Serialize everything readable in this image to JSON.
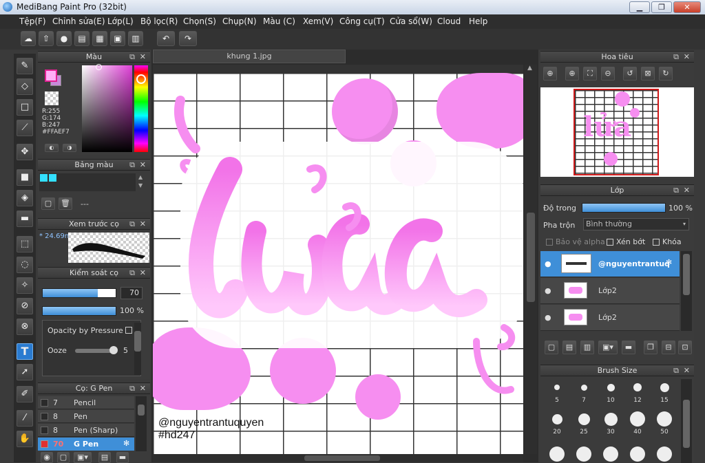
{
  "app": {
    "title": "MediBang Paint Pro (32bit)"
  },
  "window_controls": {
    "minimize": "▁",
    "maximize": "❐",
    "close": "✕"
  },
  "menu": [
    "Tệp(F)",
    "Chỉnh sửa(E)",
    "Lớp(L)",
    "Bộ lọc(R)",
    "Chọn(S)",
    "Chụp(N)",
    "Màu (C)",
    "Xem(V)",
    "Công cụ(T)",
    "Cửa sổ(W)",
    "Cloud",
    "Help"
  ],
  "document": {
    "tab": "khung 1.jpg"
  },
  "color_panel": {
    "title": "Màu",
    "rgb": {
      "r": "R:255",
      "g": "G:174",
      "b": "B:247"
    },
    "hex": "#FFAEF7",
    "colors": {
      "main": "#ffaef7",
      "sub": "#c78ad8"
    }
  },
  "palette_panel": {
    "title": "Bảng màu",
    "swatches": [
      "#33e0ff",
      "#33e0ff"
    ],
    "dash": "---"
  },
  "preview_panel": {
    "title": "Xem trước cọ",
    "value": "* 24.69n"
  },
  "brush_control": {
    "title": "Kiểm soát cọ",
    "size": "70",
    "opacity": "100 %",
    "size_fraction": 0.75,
    "opacity_fraction": 1.0,
    "opacity_pressure": "Opacity by Pressure",
    "ooze_label": "Ooze",
    "ooze_value": "5"
  },
  "brush_list": {
    "title": "Cọ: G Pen",
    "items": [
      {
        "size": "7",
        "name": "Pencil",
        "color": "#2a2a2a"
      },
      {
        "size": "8",
        "name": "Pen",
        "color": "#2a2a2a"
      },
      {
        "size": "8",
        "name": "Pen (Sharp)",
        "color": "#2a2a2a"
      },
      {
        "size": "70",
        "name": "G Pen",
        "color": "#e03030"
      }
    ]
  },
  "navigator": {
    "title": "Hoa tiêu"
  },
  "layers": {
    "title": "Lớp",
    "opacity_label": "Độ trong",
    "opacity_value": "100 %",
    "opacity_fraction": 1.0,
    "blend_label": "Pha trộn",
    "blend_value": "Bình thường",
    "protect_alpha": "Bảo vệ alpha",
    "clipping": "Xén bớt",
    "lock": "Khóa",
    "items": [
      {
        "name": "@nguyentrantuq"
      },
      {
        "name": "Lớp2"
      },
      {
        "name": "Lớp2"
      }
    ]
  },
  "brush_size": {
    "title": "Brush Size",
    "sizes": [
      "5",
      "7",
      "10",
      "12",
      "15",
      "20",
      "25",
      "30",
      "40",
      "50"
    ]
  },
  "canvas": {
    "watermark_name": "@nguyentrantuquyen",
    "watermark_tag": "#hd247",
    "word": "lửa",
    "colors": {
      "pink": "#f68ef0",
      "pink_light": "#ffb8f8"
    }
  }
}
